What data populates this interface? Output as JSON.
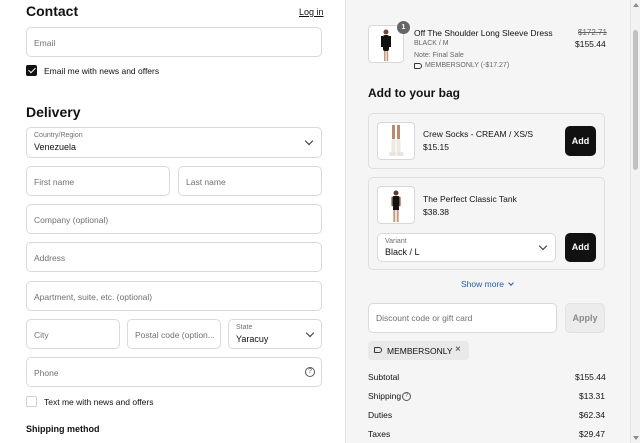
{
  "contact": {
    "heading": "Contact",
    "login_link": "Log in",
    "email_placeholder": "Email",
    "email_news_label": "Email me with news and offers",
    "email_news_checked": true
  },
  "delivery": {
    "heading": "Delivery",
    "country_label": "Country/Region",
    "country_value": "Venezuela",
    "first_name_placeholder": "First name",
    "last_name_placeholder": "Last name",
    "company_placeholder": "Company (optional)",
    "address_placeholder": "Address",
    "apartment_placeholder": "Apartment, suite, etc. (optional)",
    "city_placeholder": "City",
    "postal_placeholder": "Postal code (option...",
    "state_label": "State",
    "state_value": "Yaracuy",
    "phone_placeholder": "Phone",
    "text_news_label": "Text me with news and offers",
    "text_news_checked": false
  },
  "shipping_method": {
    "heading": "Shipping method"
  },
  "order_item": {
    "quantity": "1",
    "name": "Off The Shoulder Long Sleeve Dress",
    "variant": "BLACK / M",
    "note": "Note: Final Sale",
    "discount_code": "MEMBERSONLY (-$17.27)",
    "original_price": "$172.71",
    "price": "$155.44"
  },
  "upsell": {
    "heading": "Add to your bag",
    "items": [
      {
        "name": "Crew Socks - CREAM / XS/S",
        "price": "$15.15",
        "add_label": "Add"
      },
      {
        "name": "The Perfect Classic Tank",
        "price": "$38.38",
        "variant_label": "Variant",
        "variant_value": "Black / L",
        "add_label": "Add"
      }
    ],
    "show_more": "Show more"
  },
  "discount": {
    "placeholder": "Discount code or gift card",
    "apply_label": "Apply",
    "applied_code": "MEMBERSONLY"
  },
  "summary": {
    "subtotal_label": "Subtotal",
    "subtotal_value": "$155.44",
    "shipping_label": "Shipping",
    "shipping_value": "$13.31",
    "duties_label": "Duties",
    "duties_value": "$62.34",
    "taxes_label": "Taxes",
    "taxes_value": "$29.47"
  },
  "icons": {
    "help": "question-circle-icon",
    "chevron": "chevron-down-icon",
    "tag": "tag-icon",
    "remove": "close-icon"
  }
}
